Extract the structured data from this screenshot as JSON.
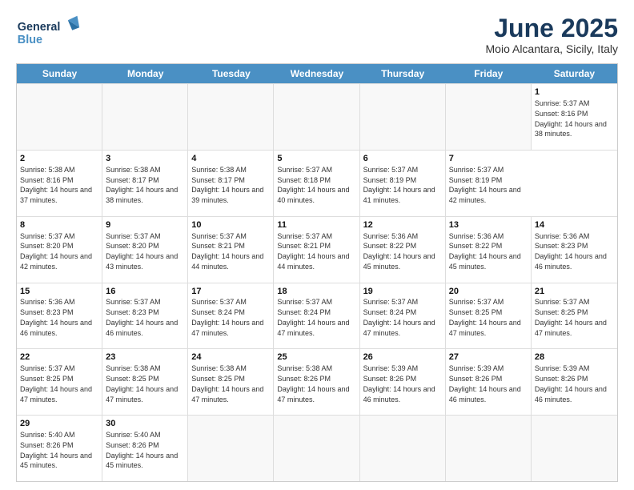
{
  "header": {
    "logo_general": "General",
    "logo_blue": "Blue",
    "month_title": "June 2025",
    "location": "Moio Alcantara, Sicily, Italy"
  },
  "calendar": {
    "days_of_week": [
      "Sunday",
      "Monday",
      "Tuesday",
      "Wednesday",
      "Thursday",
      "Friday",
      "Saturday"
    ],
    "weeks": [
      [
        {
          "day": "",
          "empty": true
        },
        {
          "day": "",
          "empty": true
        },
        {
          "day": "",
          "empty": true
        },
        {
          "day": "",
          "empty": true
        },
        {
          "day": "",
          "empty": true
        },
        {
          "day": "",
          "empty": true
        },
        {
          "day": "1",
          "sunrise": "Sunrise: 5:37 AM",
          "sunset": "Sunset: 8:16 PM",
          "daylight": "Daylight: 14 hours and 38 minutes."
        }
      ],
      [
        {
          "day": "2",
          "sunrise": "Sunrise: 5:38 AM",
          "sunset": "Sunset: 8:16 PM",
          "daylight": "Daylight: 14 hours and 37 minutes."
        },
        {
          "day": "3",
          "sunrise": "Sunrise: 5:38 AM",
          "sunset": "Sunset: 8:17 PM",
          "daylight": "Daylight: 14 hours and 38 minutes."
        },
        {
          "day": "4",
          "sunrise": "Sunrise: 5:38 AM",
          "sunset": "Sunset: 8:17 PM",
          "daylight": "Daylight: 14 hours and 39 minutes."
        },
        {
          "day": "5",
          "sunrise": "Sunrise: 5:37 AM",
          "sunset": "Sunset: 8:18 PM",
          "daylight": "Daylight: 14 hours and 40 minutes."
        },
        {
          "day": "6",
          "sunrise": "Sunrise: 5:37 AM",
          "sunset": "Sunset: 8:19 PM",
          "daylight": "Daylight: 14 hours and 41 minutes."
        },
        {
          "day": "7",
          "sunrise": "Sunrise: 5:37 AM",
          "sunset": "Sunset: 8:19 PM",
          "daylight": "Daylight: 14 hours and 42 minutes."
        }
      ],
      [
        {
          "day": "8",
          "sunrise": "Sunrise: 5:37 AM",
          "sunset": "Sunset: 8:20 PM",
          "daylight": "Daylight: 14 hours and 42 minutes."
        },
        {
          "day": "9",
          "sunrise": "Sunrise: 5:37 AM",
          "sunset": "Sunset: 8:20 PM",
          "daylight": "Daylight: 14 hours and 43 minutes."
        },
        {
          "day": "10",
          "sunrise": "Sunrise: 5:37 AM",
          "sunset": "Sunset: 8:21 PM",
          "daylight": "Daylight: 14 hours and 44 minutes."
        },
        {
          "day": "11",
          "sunrise": "Sunrise: 5:37 AM",
          "sunset": "Sunset: 8:21 PM",
          "daylight": "Daylight: 14 hours and 44 minutes."
        },
        {
          "day": "12",
          "sunrise": "Sunrise: 5:36 AM",
          "sunset": "Sunset: 8:22 PM",
          "daylight": "Daylight: 14 hours and 45 minutes."
        },
        {
          "day": "13",
          "sunrise": "Sunrise: 5:36 AM",
          "sunset": "Sunset: 8:22 PM",
          "daylight": "Daylight: 14 hours and 45 minutes."
        },
        {
          "day": "14",
          "sunrise": "Sunrise: 5:36 AM",
          "sunset": "Sunset: 8:23 PM",
          "daylight": "Daylight: 14 hours and 46 minutes."
        }
      ],
      [
        {
          "day": "15",
          "sunrise": "Sunrise: 5:36 AM",
          "sunset": "Sunset: 8:23 PM",
          "daylight": "Daylight: 14 hours and 46 minutes."
        },
        {
          "day": "16",
          "sunrise": "Sunrise: 5:37 AM",
          "sunset": "Sunset: 8:23 PM",
          "daylight": "Daylight: 14 hours and 46 minutes."
        },
        {
          "day": "17",
          "sunrise": "Sunrise: 5:37 AM",
          "sunset": "Sunset: 8:24 PM",
          "daylight": "Daylight: 14 hours and 47 minutes."
        },
        {
          "day": "18",
          "sunrise": "Sunrise: 5:37 AM",
          "sunset": "Sunset: 8:24 PM",
          "daylight": "Daylight: 14 hours and 47 minutes."
        },
        {
          "day": "19",
          "sunrise": "Sunrise: 5:37 AM",
          "sunset": "Sunset: 8:24 PM",
          "daylight": "Daylight: 14 hours and 47 minutes."
        },
        {
          "day": "20",
          "sunrise": "Sunrise: 5:37 AM",
          "sunset": "Sunset: 8:25 PM",
          "daylight": "Daylight: 14 hours and 47 minutes."
        },
        {
          "day": "21",
          "sunrise": "Sunrise: 5:37 AM",
          "sunset": "Sunset: 8:25 PM",
          "daylight": "Daylight: 14 hours and 47 minutes."
        }
      ],
      [
        {
          "day": "22",
          "sunrise": "Sunrise: 5:37 AM",
          "sunset": "Sunset: 8:25 PM",
          "daylight": "Daylight: 14 hours and 47 minutes."
        },
        {
          "day": "23",
          "sunrise": "Sunrise: 5:38 AM",
          "sunset": "Sunset: 8:25 PM",
          "daylight": "Daylight: 14 hours and 47 minutes."
        },
        {
          "day": "24",
          "sunrise": "Sunrise: 5:38 AM",
          "sunset": "Sunset: 8:25 PM",
          "daylight": "Daylight: 14 hours and 47 minutes."
        },
        {
          "day": "25",
          "sunrise": "Sunrise: 5:38 AM",
          "sunset": "Sunset: 8:26 PM",
          "daylight": "Daylight: 14 hours and 47 minutes."
        },
        {
          "day": "26",
          "sunrise": "Sunrise: 5:39 AM",
          "sunset": "Sunset: 8:26 PM",
          "daylight": "Daylight: 14 hours and 46 minutes."
        },
        {
          "day": "27",
          "sunrise": "Sunrise: 5:39 AM",
          "sunset": "Sunset: 8:26 PM",
          "daylight": "Daylight: 14 hours and 46 minutes."
        },
        {
          "day": "28",
          "sunrise": "Sunrise: 5:39 AM",
          "sunset": "Sunset: 8:26 PM",
          "daylight": "Daylight: 14 hours and 46 minutes."
        }
      ],
      [
        {
          "day": "29",
          "sunrise": "Sunrise: 5:40 AM",
          "sunset": "Sunset: 8:26 PM",
          "daylight": "Daylight: 14 hours and 45 minutes."
        },
        {
          "day": "30",
          "sunrise": "Sunrise: 5:40 AM",
          "sunset": "Sunset: 8:26 PM",
          "daylight": "Daylight: 14 hours and 45 minutes."
        },
        {
          "day": "",
          "empty": true
        },
        {
          "day": "",
          "empty": true
        },
        {
          "day": "",
          "empty": true
        },
        {
          "day": "",
          "empty": true
        },
        {
          "day": "",
          "empty": true
        }
      ]
    ]
  }
}
